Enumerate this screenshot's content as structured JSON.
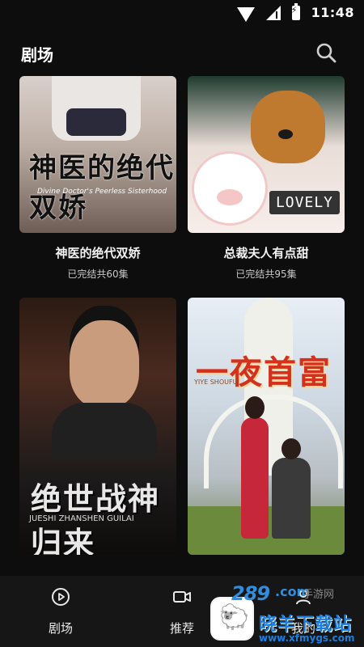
{
  "status_bar": {
    "time": "11:48"
  },
  "header": {
    "title": "剧场"
  },
  "dramas": [
    {
      "title": "神医的绝代双娇",
      "status": "已完结共60集",
      "art_title": "神医的绝代双娇",
      "art_sub": "Divine Doctor's Peerless Sisterhood"
    },
    {
      "title": "总裁夫人有点甜",
      "status": "已完结共95集",
      "art_badge": "LOVELY"
    },
    {
      "art_title": "绝世战神归来",
      "art_sub": "JUESHI ZHANSHEN GUILAI"
    },
    {
      "art_title": "一夜首富",
      "art_sub": "YIYE SHOUFU"
    }
  ],
  "bottom_nav": [
    {
      "label": "剧场",
      "icon": "play-circle-icon"
    },
    {
      "label": "推荐",
      "icon": "video-icon"
    },
    {
      "label": "我的",
      "icon": "user-icon"
    }
  ],
  "watermark": {
    "number": "289",
    "com": ".com",
    "sub": "手游网",
    "brand": "晓羊下载站",
    "url": "www.xfmygs.com"
  },
  "colors": {
    "background": "#0d0d0d",
    "nav_background": "#161616",
    "watermark_blue": "#1c7fe0"
  }
}
